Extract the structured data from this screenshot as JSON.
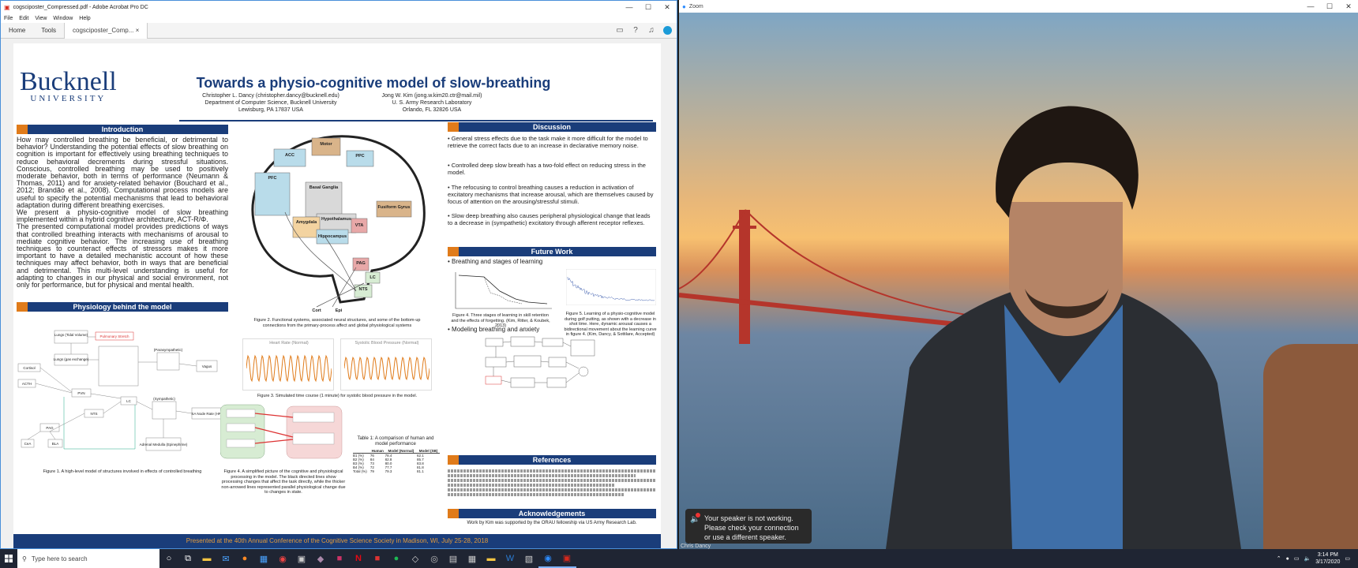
{
  "acrobat": {
    "window_title": "cogsciposter_Compressed.pdf - Adobe Acrobat Pro DC",
    "menu": [
      "File",
      "Edit",
      "View",
      "Window",
      "Help"
    ],
    "tabs": {
      "home": "Home",
      "tools": "Tools",
      "doc": "cogsciposter_Comp...",
      "close": "×"
    },
    "poster": {
      "logo_top": "Bucknell",
      "logo_bottom": "UNIVERSITY",
      "title": "Towards a physio-cognitive model of slow-breathing",
      "author1": [
        "Christopher L. Dancy (christopher.dancy@bucknell.edu)",
        "Department of Computer Science, Bucknell University",
        "Lewisburg, PA 17837 USA"
      ],
      "author2": [
        "Jong W. Kim (jong.w.kim20.ctr@mail.mil)",
        "U. S. Army Research Laboratory",
        "Orlando, FL 32826 USA"
      ],
      "intro_header": "Introduction",
      "intro_p1": "How may controlled breathing be beneficial, or detrimental to behavior? Understanding the potential effects of slow breathing on cognition is important for effectively using breathing techniques to reduce behavioral decrements during stressful situations. Conscious, controlled breathing may be used to positively moderate behavior, both in terms of performance (Neumann & Thomas, 2011) and for anxiety-related behavior (Bouchard et al., 2012; Brandão et al., 2008). Computational process models are useful to specify the potential mechanisms that lead to behavioral adaptation during different breathing exercises.",
      "intro_p2": "We present a physio-cognitive model of slow breathing implemented within a hybrid cognitive architecture, ACT-R/Φ.",
      "intro_p3": "The presented computational model provides predictions of ways that controlled breathing interacts with mechanisms of arousal to mediate cognitive behavior. The increasing use of breathing techniques to counteract effects of stressors makes it more important to have a detailed mechanistic account of how these techniques may affect behavior, both in ways that are beneficial and detrimental. This multi-level understanding is useful for adapting to changes in our physical and social environment, not only for performance, but for physical and mental health.",
      "physio_header": "Physiology behind the model",
      "discussion_header": "Discussion",
      "disc1": "• General stress effects due to the task make it more difficult for the model to retrieve the correct facts due to an increase in declarative memory noise.",
      "disc2": "• Controlled deep slow breath has a two-fold effect on reducing stress in the model.",
      "disc3": "• The refocusing to control breathing causes a reduction in activation of excitatory mechanisms that increase arousal, which are themselves caused by focus of attention on the arousing/stressful stimuli.",
      "disc4": "• Slow deep breathing also causes peripheral physiological change that leads to a decrease in (sympathetic) excitatory through afferent receptor reflexes.",
      "future_header": "Future Work",
      "fw1": "• Breathing and stages of learning",
      "fw2": "• Modeling breathing and anxiety",
      "refs_header": "References",
      "ack_header": "Acknowledgements",
      "ack": "Work by Kim was supported by the ORAU fellowship via US Army Research Lab.",
      "fig1": "Figure 1. A high-level model of structures involved in effects of controlled breathing",
      "fig2": "Figure 2. Functional systems, associated neural structures, and some of the bottom-up connections from the primary-process affect and global physiological systems",
      "fig3": "Figure 3. Simulated time course (1 minute) for systolic blood pressure in the model.",
      "fig4": "Figure 4. A simplified picture of the cognitive and physiological processing in the model. The black directed lines show processing changes that affect the task directly, while the thicker non-arrowed lines represented parallel physiological change due to changes in state.",
      "fig5": "Figure 4. Three stages of learning in skill retention and the effects of forgetting. (Kim, Ritter, & Koubek, 2013)",
      "fig6": "Figure 5. Learning of a physio-cognitive model during golf putting, as shown with a decrease in shot time. Here, dynamic arousal causes a bidirectional movement about the learning curve in figure 4. (Kim, Dancy, & Sottilare, Accepted)",
      "table_caption": "Table 1: A comparison of human and model performance",
      "table_head": [
        "",
        "Human",
        "Model (Normal)",
        "Model (SB)"
      ],
      "table_rows": [
        [
          "B1 (%)",
          "76",
          "78.4",
          "62.1"
        ],
        [
          "B2 (%)",
          "84",
          "82.8",
          "85.7"
        ],
        [
          "B3 (%)",
          "73",
          "80.0",
          "83.8"
        ],
        [
          "B4 (%)",
          "72",
          "77.7",
          "81.8"
        ],
        [
          "Total (%)",
          "79",
          "79.3",
          "81.1"
        ]
      ],
      "footer": "Presented at the 40th Annual Conference of the Cognitive Science Society in Madison, WI, July 25-28, 2018",
      "brain_labels": [
        "Motor",
        "ACC",
        "PPC",
        "PFC",
        "Basal Ganglia",
        "Hypothalamus",
        "Amygdala",
        "Hippocampus",
        "VTA",
        "Fusiform Gyrus",
        "PAG",
        "LC",
        "NTS",
        "Cort",
        "Epi"
      ],
      "fig1_labels": [
        "Lungs (Tidal Volume)",
        "Pulmonary Stretch",
        "Lungs (gas exchange)",
        "Cortisol",
        "ACTH",
        "PVN",
        "NTS",
        "LC",
        "PAG",
        "CeA",
        "BLA",
        "(Parasympathetic)",
        "Vagus",
        "(Sympathetic)",
        "SA Node Rate (HR)",
        "Adrenal Medulla (Epinephrine)"
      ],
      "chart_titles": [
        "Heart Rate (Normal)",
        "Systolic Blood Pressure (Normal)"
      ]
    }
  },
  "zoom": {
    "window_title": "Zoom",
    "notice": "Your speaker is not working. Please check your connection or use a different speaker.",
    "participant": "Chris Dancy"
  },
  "taskbar": {
    "search_placeholder": "Type here to search",
    "time": "3:14 PM",
    "date": "3/17/2020"
  }
}
